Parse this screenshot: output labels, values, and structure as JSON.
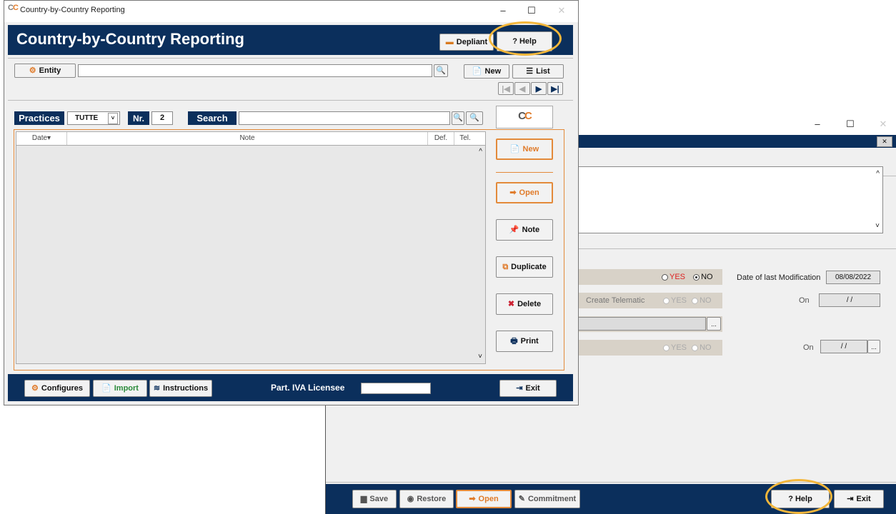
{
  "main_window": {
    "title": "Country-by-Country Reporting",
    "header_title": "Country-by-Country Reporting",
    "depliant_label": "Depliant",
    "help_label": "? Help",
    "entity_label": "Entity",
    "new_label": "New",
    "list_label": "List",
    "practices_label": "Practices",
    "practices_value": "TUTTE",
    "nr_label": "Nr.",
    "nr_value": "2",
    "search_label": "Search",
    "columns": [
      "Date",
      "Note",
      "Def.",
      "Tel."
    ],
    "actions": {
      "new": "New",
      "open": "Open",
      "note": "Note",
      "duplicate": "Duplicate",
      "delete": "Delete",
      "print": "Print"
    },
    "footer": {
      "configures": "Configures",
      "import": "Import",
      "instructions": "Instructions",
      "licensee_label": "Part. IVA Licensee",
      "exit": "Exit"
    }
  },
  "second_window": {
    "yes_label": "YES",
    "no_label": "NO",
    "date_mod_label": "Date of last Modification",
    "date_mod_value": "08/08/2022",
    "create_telematic_label": "Create Telematic",
    "on_label": "On",
    "on_value": "/ /",
    "ellipsis": "...",
    "footer": {
      "save": "Save",
      "restore": "Restore",
      "open": "Open",
      "commitment": "Commitment",
      "help": "? Help",
      "exit": "Exit"
    }
  },
  "colors": {
    "navy": "#0b2f5c",
    "orange": "#e38a3a",
    "highlight": "#f3b63a"
  }
}
